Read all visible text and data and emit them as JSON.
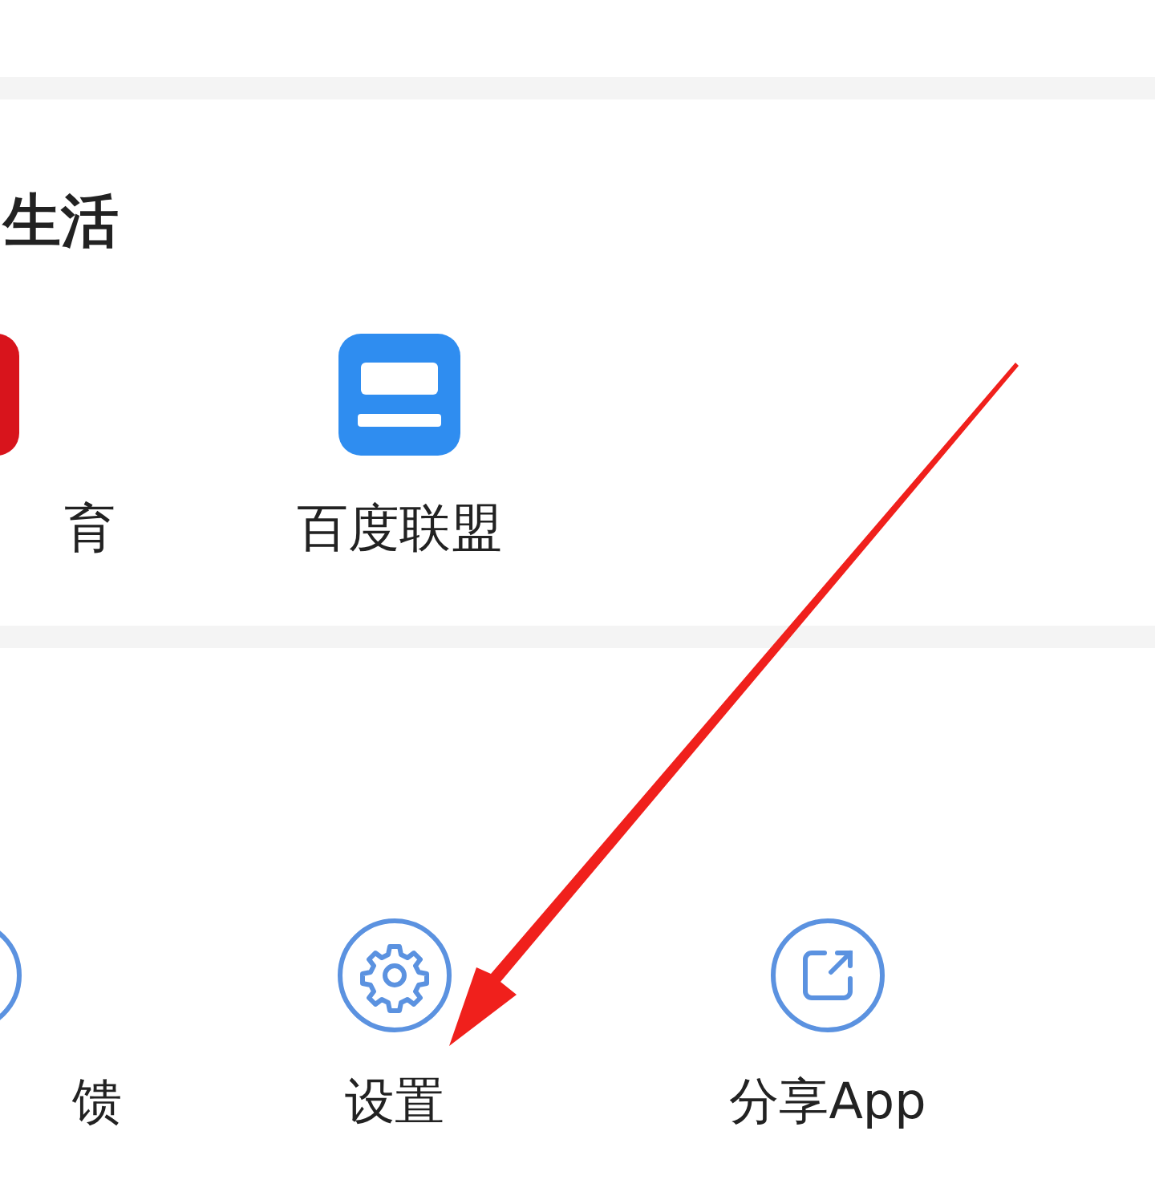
{
  "life_section": {
    "title": "生活",
    "apps": [
      {
        "label": "育",
        "kind": "sports"
      },
      {
        "label": "百度联盟",
        "kind": "news"
      }
    ]
  },
  "tools_section": {
    "items": [
      {
        "label": "馈",
        "kind": "feedback"
      },
      {
        "label": "设置",
        "kind": "settings"
      },
      {
        "label": "分享App",
        "kind": "share"
      }
    ]
  }
}
